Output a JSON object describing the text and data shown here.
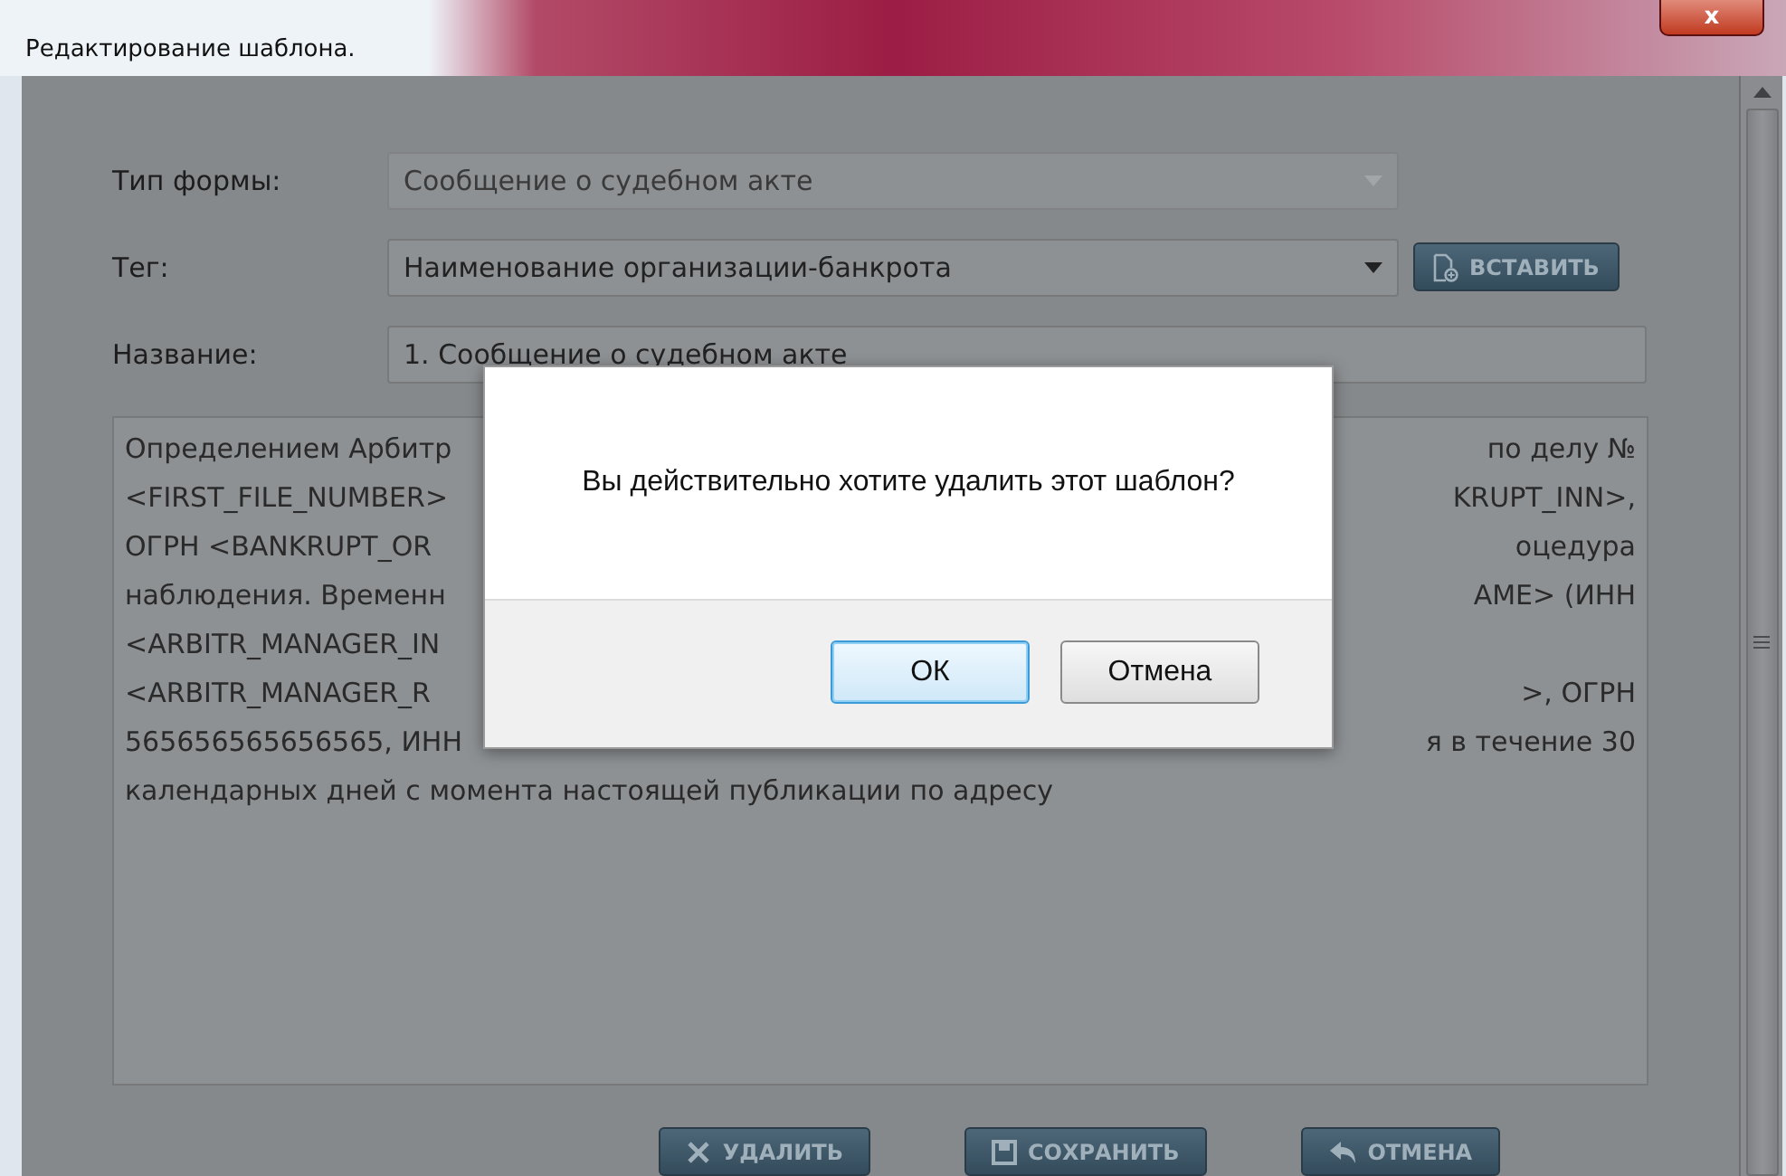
{
  "window": {
    "title": "Редактирование шаблона.",
    "close": "x"
  },
  "form": {
    "fields": [
      {
        "label": "Тип формы:",
        "value": "Сообщение о судебном акте",
        "kind": "select",
        "disabled": true
      },
      {
        "label": "Тег:",
        "value": "Наименование организации-банкрота",
        "kind": "select",
        "disabled": false
      },
      {
        "label": "Название:",
        "value": "1. Сообщение о судебном акте",
        "kind": "text",
        "disabled": false
      }
    ],
    "insert_button": "ВСТАВИТЬ",
    "body_lines": [
      {
        "left": "Определением Арбитр",
        "right": "по делу №"
      },
      {
        "left": "<FIRST_FILE_NUMBER>",
        "right": "KRUPT_INN>,"
      },
      {
        "left": "ОГРН <BANKRUPT_OR",
        "right": "оцедура"
      },
      {
        "left": "наблюдения. Временн",
        "right": "AME> (ИНН"
      },
      {
        "left": "<ARBITR_MANAGER_IN"
      },
      {
        "left": "<ARBITR_MANAGER_R",
        "right": ">, ОГРН"
      },
      {
        "left": "565656565656565, ИНН",
        "right": "я в течение 30"
      },
      {
        "left": "календарных дней с момента настоящей публикации по адресу"
      }
    ],
    "buttons": [
      {
        "label": "УДАЛИТЬ",
        "kind": "delete"
      },
      {
        "label": "СОХРАНИТЬ",
        "kind": "save"
      },
      {
        "label": "ОТМЕНА",
        "kind": "cancel"
      }
    ]
  },
  "dialog": {
    "message": "Вы действительно хотите удалить этот шаблон?",
    "buttons": [
      {
        "label": "ОК",
        "selected": true
      },
      {
        "label": "Отмена",
        "selected": false
      }
    ]
  }
}
